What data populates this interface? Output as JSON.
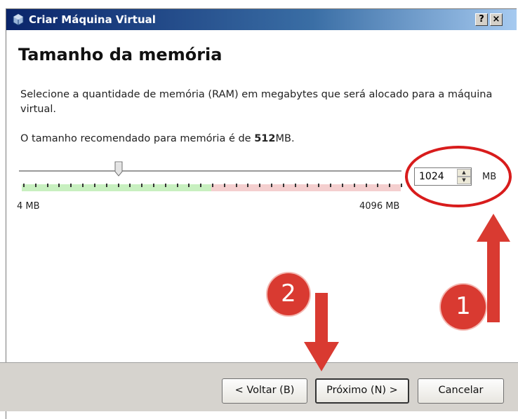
{
  "window": {
    "title": "Criar Máquina Virtual",
    "help_label": "?",
    "close_label": "×"
  },
  "page": {
    "heading": "Tamanho da memória",
    "description": "Selecione a quantidade de memória (RAM) em megabytes que será alocado para a máquina virtual.",
    "recommend_prefix": "O tamanho recomendado para memória é de ",
    "recommend_value": "512",
    "recommend_unit": "MB."
  },
  "memory": {
    "value": "1024",
    "unit": "MB",
    "min_label": "4 MB",
    "max_label": "4096 MB",
    "slider_min": 4,
    "slider_max": 4096,
    "slider_value": 1024,
    "recommended_zone_end_fraction": 0.5
  },
  "buttons": {
    "back": "< Voltar (B)",
    "next": "Próximo (N) >",
    "cancel": "Cancelar"
  },
  "annotations": {
    "badge_1": "1",
    "badge_2": "2",
    "color": "#d93a31"
  }
}
